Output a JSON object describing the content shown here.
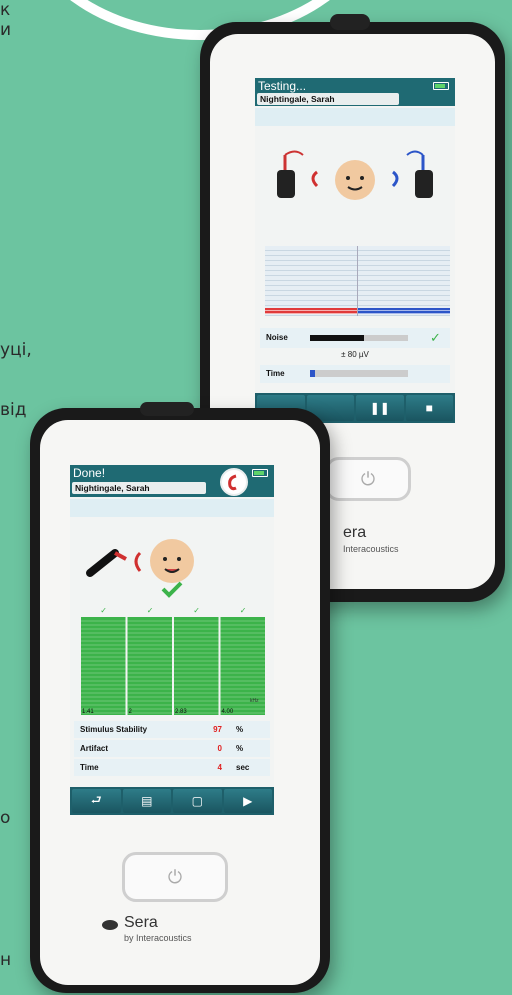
{
  "fragments": {
    "a": "к",
    "b": "и",
    "c": "уці,",
    "d": "від",
    "e": "о",
    "f": "н"
  },
  "back_device": {
    "title": "Testing...",
    "patient": "Nightingale, Sarah",
    "noise_label": "Noise",
    "noise_value": "± 80 µV",
    "time_label": "Time",
    "brand": "era",
    "brand_sub": "Interacoustics",
    "noise_level": 0.55,
    "time_progress": 0.05,
    "colors": {
      "left": "#e03a3a",
      "right": "#2c55c8",
      "header": "#1f6a73"
    },
    "buttons": [
      "",
      "",
      "pause-icon",
      "stop-icon"
    ]
  },
  "front_device": {
    "title": "Done!",
    "patient": "Nightingale, Sarah",
    "freq_unit": "kHz",
    "freqs": [
      "1.41",
      "2",
      "2.83",
      "4.00"
    ],
    "rows": [
      {
        "label": "Stimulus Stability",
        "value": "97",
        "unit": "%"
      },
      {
        "label": "Artifact",
        "value": "0",
        "unit": "%"
      },
      {
        "label": "Time",
        "value": "4",
        "unit": "sec"
      }
    ],
    "brand": "Sera",
    "brand_sub": "by Interacoustics",
    "buttons": [
      "return-icon",
      "clipboard-icon",
      "comment-icon",
      "play-icon"
    ],
    "colors": {
      "pass": "#3cb34a",
      "value": "#e02020"
    }
  }
}
